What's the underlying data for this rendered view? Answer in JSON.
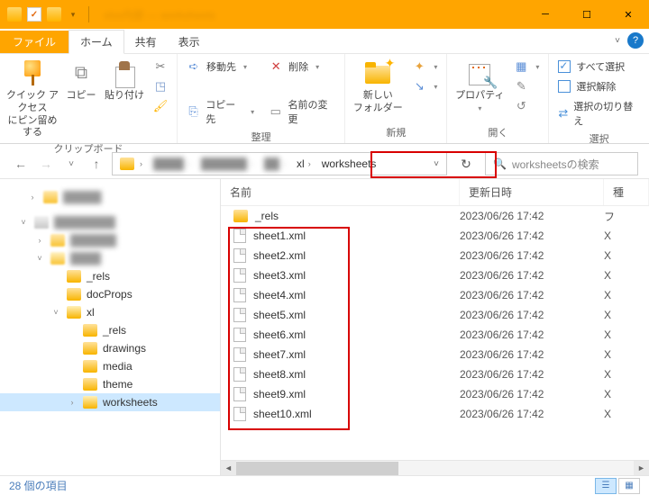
{
  "titlebar": {
    "title": "xlsx内部 — worksheets"
  },
  "tabs": {
    "file": "ファイル",
    "home": "ホーム",
    "share": "共有",
    "view": "表示"
  },
  "ribbon": {
    "pin_l1": "クイック アクセス",
    "pin_l2": "にピン留めする",
    "copy": "コピー",
    "paste": "貼り付け",
    "clipboard": "クリップボード",
    "moveto": "移動先",
    "copyto": "コピー先",
    "delete": "削除",
    "rename": "名前の変更",
    "organize": "整理",
    "newfolder_l1": "新しい",
    "newfolder_l2": "フォルダー",
    "new": "新規",
    "properties": "プロパティ",
    "open": "開く",
    "selectall": "すべて選択",
    "selectnone": "選択解除",
    "selectinv": "選択の切り替え",
    "select": "選択"
  },
  "breadcrumb": {
    "seg_xl": "xl",
    "seg_ws": "worksheets",
    "search_placeholder": "worksheetsの検索"
  },
  "tree": {
    "rels": "_rels",
    "docprops": "docProps",
    "xl": "xl",
    "xl_rels": "_rels",
    "drawings": "drawings",
    "media": "media",
    "theme": "theme",
    "worksheets": "worksheets"
  },
  "headers": {
    "name": "名前",
    "date": "更新日時",
    "type": "種"
  },
  "files": [
    {
      "name": "_rels",
      "date": "2023/06/26 17:42",
      "type": "フ",
      "folder": true
    },
    {
      "name": "sheet1.xml",
      "date": "2023/06/26 17:42",
      "type": "X"
    },
    {
      "name": "sheet2.xml",
      "date": "2023/06/26 17:42",
      "type": "X"
    },
    {
      "name": "sheet3.xml",
      "date": "2023/06/26 17:42",
      "type": "X"
    },
    {
      "name": "sheet4.xml",
      "date": "2023/06/26 17:42",
      "type": "X"
    },
    {
      "name": "sheet5.xml",
      "date": "2023/06/26 17:42",
      "type": "X"
    },
    {
      "name": "sheet6.xml",
      "date": "2023/06/26 17:42",
      "type": "X"
    },
    {
      "name": "sheet7.xml",
      "date": "2023/06/26 17:42",
      "type": "X"
    },
    {
      "name": "sheet8.xml",
      "date": "2023/06/26 17:42",
      "type": "X"
    },
    {
      "name": "sheet9.xml",
      "date": "2023/06/26 17:42",
      "type": "X"
    },
    {
      "name": "sheet10.xml",
      "date": "2023/06/26 17:42",
      "type": "X"
    }
  ],
  "status": {
    "count": "28 個の項目"
  }
}
